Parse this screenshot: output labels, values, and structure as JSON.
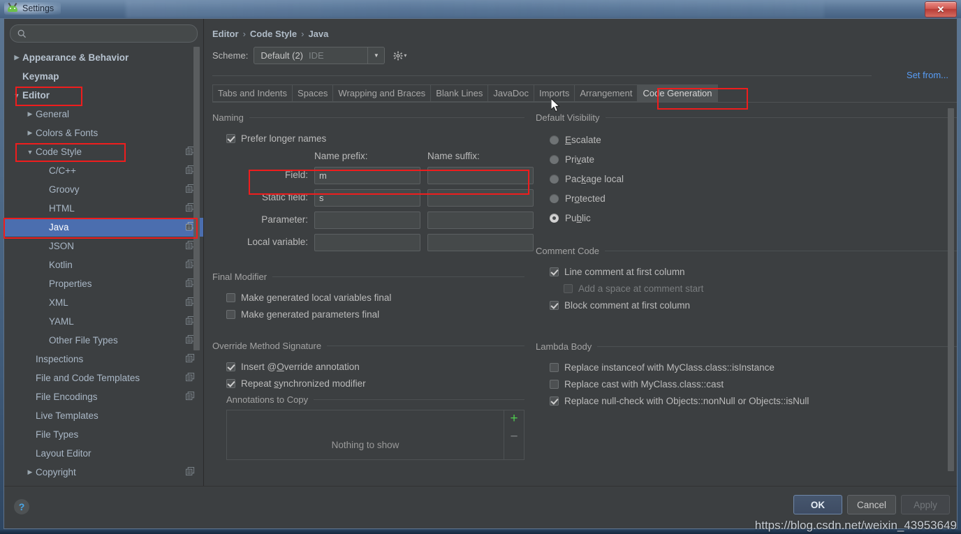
{
  "window": {
    "title": "Settings",
    "app_icon": "android-studio-icon",
    "close_label": "✕"
  },
  "sidebar": {
    "search": {
      "value": "",
      "placeholder": ""
    },
    "items": [
      {
        "label": "Appearance & Behavior",
        "arrow": "collapsed",
        "indent": 0,
        "bold": true,
        "copy": false,
        "selected": false
      },
      {
        "label": "Keymap",
        "arrow": "none",
        "indent": 0,
        "bold": true,
        "copy": false,
        "selected": false
      },
      {
        "label": "Editor",
        "arrow": "expanded",
        "indent": 0,
        "bold": true,
        "copy": false,
        "selected": false
      },
      {
        "label": "General",
        "arrow": "collapsed",
        "indent": 1,
        "bold": false,
        "copy": false,
        "selected": false
      },
      {
        "label": "Colors & Fonts",
        "arrow": "collapsed",
        "indent": 1,
        "bold": false,
        "copy": false,
        "selected": false
      },
      {
        "label": "Code Style",
        "arrow": "expanded",
        "indent": 1,
        "bold": false,
        "copy": true,
        "selected": false
      },
      {
        "label": "C/C++",
        "arrow": "none",
        "indent": 2,
        "bold": false,
        "copy": true,
        "selected": false
      },
      {
        "label": "Groovy",
        "arrow": "none",
        "indent": 2,
        "bold": false,
        "copy": true,
        "selected": false
      },
      {
        "label": "HTML",
        "arrow": "none",
        "indent": 2,
        "bold": false,
        "copy": true,
        "selected": false
      },
      {
        "label": "Java",
        "arrow": "none",
        "indent": 2,
        "bold": false,
        "copy": true,
        "selected": true
      },
      {
        "label": "JSON",
        "arrow": "none",
        "indent": 2,
        "bold": false,
        "copy": true,
        "selected": false
      },
      {
        "label": "Kotlin",
        "arrow": "none",
        "indent": 2,
        "bold": false,
        "copy": true,
        "selected": false
      },
      {
        "label": "Properties",
        "arrow": "none",
        "indent": 2,
        "bold": false,
        "copy": true,
        "selected": false
      },
      {
        "label": "XML",
        "arrow": "none",
        "indent": 2,
        "bold": false,
        "copy": true,
        "selected": false
      },
      {
        "label": "YAML",
        "arrow": "none",
        "indent": 2,
        "bold": false,
        "copy": true,
        "selected": false
      },
      {
        "label": "Other File Types",
        "arrow": "none",
        "indent": 2,
        "bold": false,
        "copy": true,
        "selected": false
      },
      {
        "label": "Inspections",
        "arrow": "none",
        "indent": 1,
        "bold": false,
        "copy": true,
        "selected": false
      },
      {
        "label": "File and Code Templates",
        "arrow": "none",
        "indent": 1,
        "bold": false,
        "copy": true,
        "selected": false
      },
      {
        "label": "File Encodings",
        "arrow": "none",
        "indent": 1,
        "bold": false,
        "copy": true,
        "selected": false
      },
      {
        "label": "Live Templates",
        "arrow": "none",
        "indent": 1,
        "bold": false,
        "copy": false,
        "selected": false
      },
      {
        "label": "File Types",
        "arrow": "none",
        "indent": 1,
        "bold": false,
        "copy": false,
        "selected": false
      },
      {
        "label": "Layout Editor",
        "arrow": "none",
        "indent": 1,
        "bold": false,
        "copy": false,
        "selected": false
      },
      {
        "label": "Copyright",
        "arrow": "collapsed",
        "indent": 1,
        "bold": false,
        "copy": true,
        "selected": false
      }
    ]
  },
  "breadcrumb": {
    "part1": "Editor",
    "sep1": "›",
    "part2": "Code Style",
    "sep2": "›",
    "part3": "Java"
  },
  "scheme": {
    "label": "Scheme:",
    "value": "Default (2)",
    "value_suffix": "IDE",
    "arrow": "▼",
    "gear_icon": "gear-icon",
    "set_from_label": "Set from..."
  },
  "tabs": [
    {
      "label": "Tabs and Indents",
      "active": false
    },
    {
      "label": "Spaces",
      "active": false
    },
    {
      "label": "Wrapping and Braces",
      "active": false
    },
    {
      "label": "Blank Lines",
      "active": false
    },
    {
      "label": "JavaDoc",
      "active": false
    },
    {
      "label": "Imports",
      "active": false
    },
    {
      "label": "Arrangement",
      "active": false
    },
    {
      "label": "Code Generation",
      "active": true
    }
  ],
  "naming": {
    "title": "Naming",
    "prefer_longer_names": {
      "label": "Prefer longer names",
      "checked": true
    },
    "col_prefix": "Name prefix:",
    "col_suffix": "Name suffix:",
    "rows": [
      {
        "label": "Field:",
        "prefix": "m",
        "suffix": ""
      },
      {
        "label": "Static field:",
        "prefix": "s",
        "suffix": ""
      },
      {
        "label": "Parameter:",
        "prefix": "",
        "suffix": ""
      },
      {
        "label": "Local variable:",
        "prefix": "",
        "suffix": ""
      }
    ]
  },
  "final_modifier": {
    "title": "Final Modifier",
    "items": [
      {
        "label": "Make generated local variables final",
        "checked": false,
        "disabled": false
      },
      {
        "label": "Make generated parameters final",
        "checked": false,
        "disabled": false
      }
    ]
  },
  "override_method_signature": {
    "title": "Override Method Signature",
    "items": [
      {
        "label": "Insert @Override annotation",
        "checked": true,
        "mnemonic": "O"
      },
      {
        "label": "Repeat synchronized modifier",
        "checked": true,
        "mnemonic": "s"
      }
    ],
    "annotations": {
      "title": "Annotations to Copy",
      "empty_text": "Nothing to show",
      "add_label": "+",
      "remove_label": "−"
    }
  },
  "default_visibility": {
    "title": "Default Visibility",
    "options": [
      {
        "label": "Escalate",
        "mnemonic": "E",
        "selected": false
      },
      {
        "label": "Private",
        "mnemonic": "v",
        "selected": false
      },
      {
        "label": "Package local",
        "mnemonic": "k",
        "selected": false
      },
      {
        "label": "Protected",
        "mnemonic": "o",
        "selected": false
      },
      {
        "label": "Public",
        "mnemonic": "b",
        "selected": true
      }
    ]
  },
  "comment_code": {
    "title": "Comment Code",
    "items": [
      {
        "label": "Line comment at first column",
        "checked": true,
        "disabled": false,
        "indent": 0
      },
      {
        "label": "Add a space at comment start",
        "checked": false,
        "disabled": true,
        "indent": 1
      },
      {
        "label": "Block comment at first column",
        "checked": true,
        "disabled": false,
        "indent": 0
      }
    ]
  },
  "lambda_body": {
    "title": "Lambda Body",
    "items": [
      {
        "label": "Replace instanceof with MyClass.class::isInstance",
        "checked": false
      },
      {
        "label": "Replace cast with MyClass.class::cast",
        "checked": false
      },
      {
        "label": "Replace null-check with Objects::nonNull or Objects::isNull",
        "checked": true
      }
    ]
  },
  "bottom": {
    "help_label": "?",
    "ok_label": "OK",
    "cancel_label": "Cancel",
    "apply_label": "Apply"
  },
  "watermark": "https://blog.csdn.net/weixin_43953649",
  "colors": {
    "accent_selection": "#4b6eaf",
    "link": "#589df6",
    "annotation_red": "#ef1d1d",
    "panel_bg": "#3c3f41",
    "text": "#bbbbbb"
  }
}
